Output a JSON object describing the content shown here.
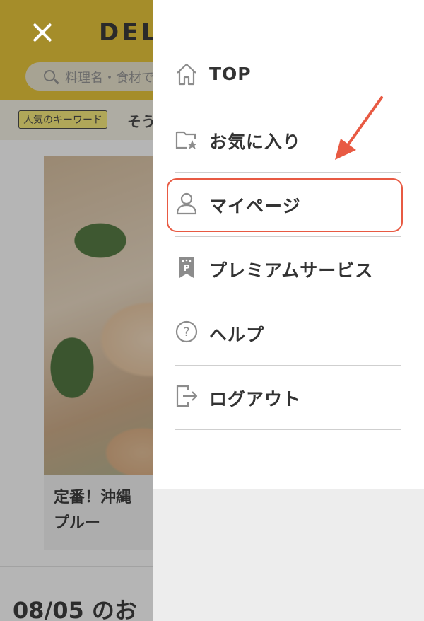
{
  "background": {
    "logo": "DELI",
    "search_placeholder": "料理名・食材で",
    "keyword_badge": "人気のキーワード",
    "keyword_first": "そう",
    "recipe_title": "定番！沖縄チャンプルー",
    "recipe_title_line1": "定番！沖縄",
    "recipe_title_line2": "プルー",
    "date_heading": "08/05 のお"
  },
  "menu": {
    "items": [
      {
        "label": "TOP",
        "icon": "home-icon"
      },
      {
        "label": "お気に入り",
        "icon": "folder-star-icon"
      },
      {
        "label": "マイページ",
        "icon": "user-icon"
      },
      {
        "label": "プレミアムサービス",
        "icon": "premium-bookmark-icon"
      },
      {
        "label": "ヘルプ",
        "icon": "help-icon"
      },
      {
        "label": "ログアウト",
        "icon": "logout-icon"
      }
    ]
  },
  "colors": {
    "header_yellow": "#e6bf1f",
    "highlight_red": "#e85a43",
    "menu_text": "#333333",
    "icon_gray": "#8c8c8c"
  }
}
